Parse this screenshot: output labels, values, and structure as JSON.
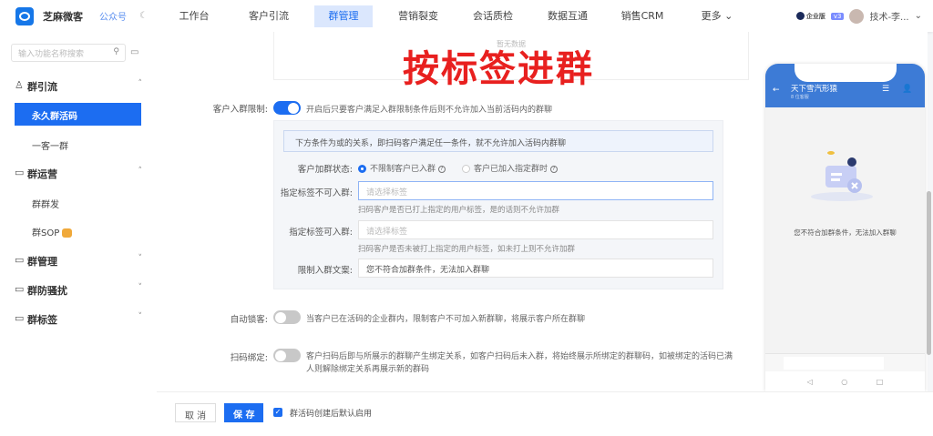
{
  "header": {
    "brand": "芝麻微客",
    "account_type": "公众号",
    "nav": [
      "工作台",
      "客户引流",
      "群管理",
      "营销裂变",
      "会话质检",
      "数据互通",
      "销售CRM",
      "更多"
    ],
    "active_nav": "群管理",
    "edition": "企业版",
    "version": "v3",
    "user": "技术-李..."
  },
  "sidebar": {
    "search_placeholder": "输入功能名称搜索",
    "groups": [
      {
        "label": "群引流",
        "expanded": true,
        "items": [
          "永久群活码",
          "一客一群"
        ]
      },
      {
        "label": "群运营",
        "expanded": true,
        "items": [
          "群群发",
          "群SOP"
        ]
      },
      {
        "label": "群管理",
        "expanded": false
      },
      {
        "label": "群防骚扰",
        "expanded": false
      },
      {
        "label": "群标签",
        "expanded": false
      }
    ],
    "active_item": "永久群活码"
  },
  "main": {
    "empty_text": "暂无数据",
    "overlay_title": "按标签进群",
    "limit": {
      "label": "客户入群限制:",
      "enabled": true,
      "desc": "开启后只要客户满足入群限制条件后则不允许加入当前活码内的群聊",
      "tip": "下方条件为或的关系，即扫码客户满足任一条件，就不允许加入活码内群聊",
      "status_label": "客户加群状态:",
      "status_options": [
        "不限制客户已入群",
        "客户已加入指定群时"
      ],
      "status_selected": "不限制客户已入群",
      "deny_tag_label": "指定标签不可入群:",
      "deny_tag_placeholder": "请选择标签",
      "deny_tag_hint": "扫码客户是否已打上指定的用户标签，是的话则不允许加群",
      "allow_tag_label": "指定标签可入群:",
      "allow_tag_placeholder": "请选择标签",
      "allow_tag_hint": "扫码客户是否未被打上指定的用户标签，如未打上则不允许加群",
      "text_label": "限制入群文案:",
      "text_value": "您不符合加群条件，无法加入群聊"
    },
    "auto_lock": {
      "label": "自动锁客:",
      "enabled": false,
      "desc": "当客户已在活码的企业群内，限制客户不可加入新群聊，将展示客户所在群聊"
    },
    "scan_bind": {
      "label": "扫码绑定:",
      "enabled": false,
      "desc1": "客户扫码后即与所展示的群聊产生绑定关系，如客户扫码后未入群，将始终展示所绑定的群聊码，如被绑定的活码已满",
      "desc2": "人则解除绑定关系再展示新的群码"
    }
  },
  "phone": {
    "title": "天下雪汽形猿",
    "subtitle": "8 位客服",
    "message": "您不符合加群条件，无法加入群聊"
  },
  "footer": {
    "cancel": "取 消",
    "save": "保 存",
    "checkbox_label": "群活码创建后默认启用",
    "checkbox_checked": true
  },
  "colors": {
    "accent": "#1c6df1",
    "stamp": "#e8201f"
  }
}
